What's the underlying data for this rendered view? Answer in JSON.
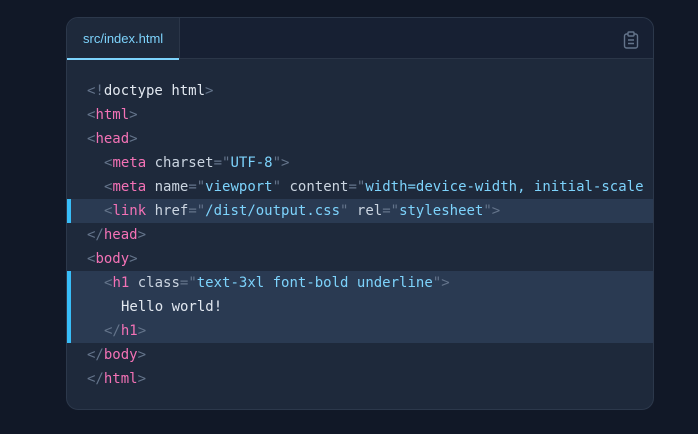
{
  "editor": {
    "tab": {
      "filename": "src/index.html"
    },
    "copy_icon": "clipboard-icon",
    "colors": {
      "background": "#1e293b",
      "accent": "#7dd3fc",
      "highlight_bar": "#38bdf8",
      "tag": "#f472b6",
      "punctuation": "#64748b",
      "string": "#7dd3fc"
    },
    "code": {
      "doctype_keyword": "doctype",
      "doctype_value": "html",
      "tag_html": "html",
      "tag_head": "head",
      "tag_meta": "meta",
      "attr_charset": "charset",
      "val_charset": "UTF-8",
      "attr_name": "name",
      "val_viewport": "viewport",
      "attr_content": "content",
      "val_content": "width=device-width, initial-scale",
      "tag_link": "link",
      "attr_href": "href",
      "val_href": "/dist/output.css",
      "attr_rel": "rel",
      "val_rel": "stylesheet",
      "tag_body": "body",
      "tag_h1": "h1",
      "attr_class": "class",
      "val_class": "text-3xl font-bold underline",
      "text_h1": "Hello world!"
    }
  }
}
